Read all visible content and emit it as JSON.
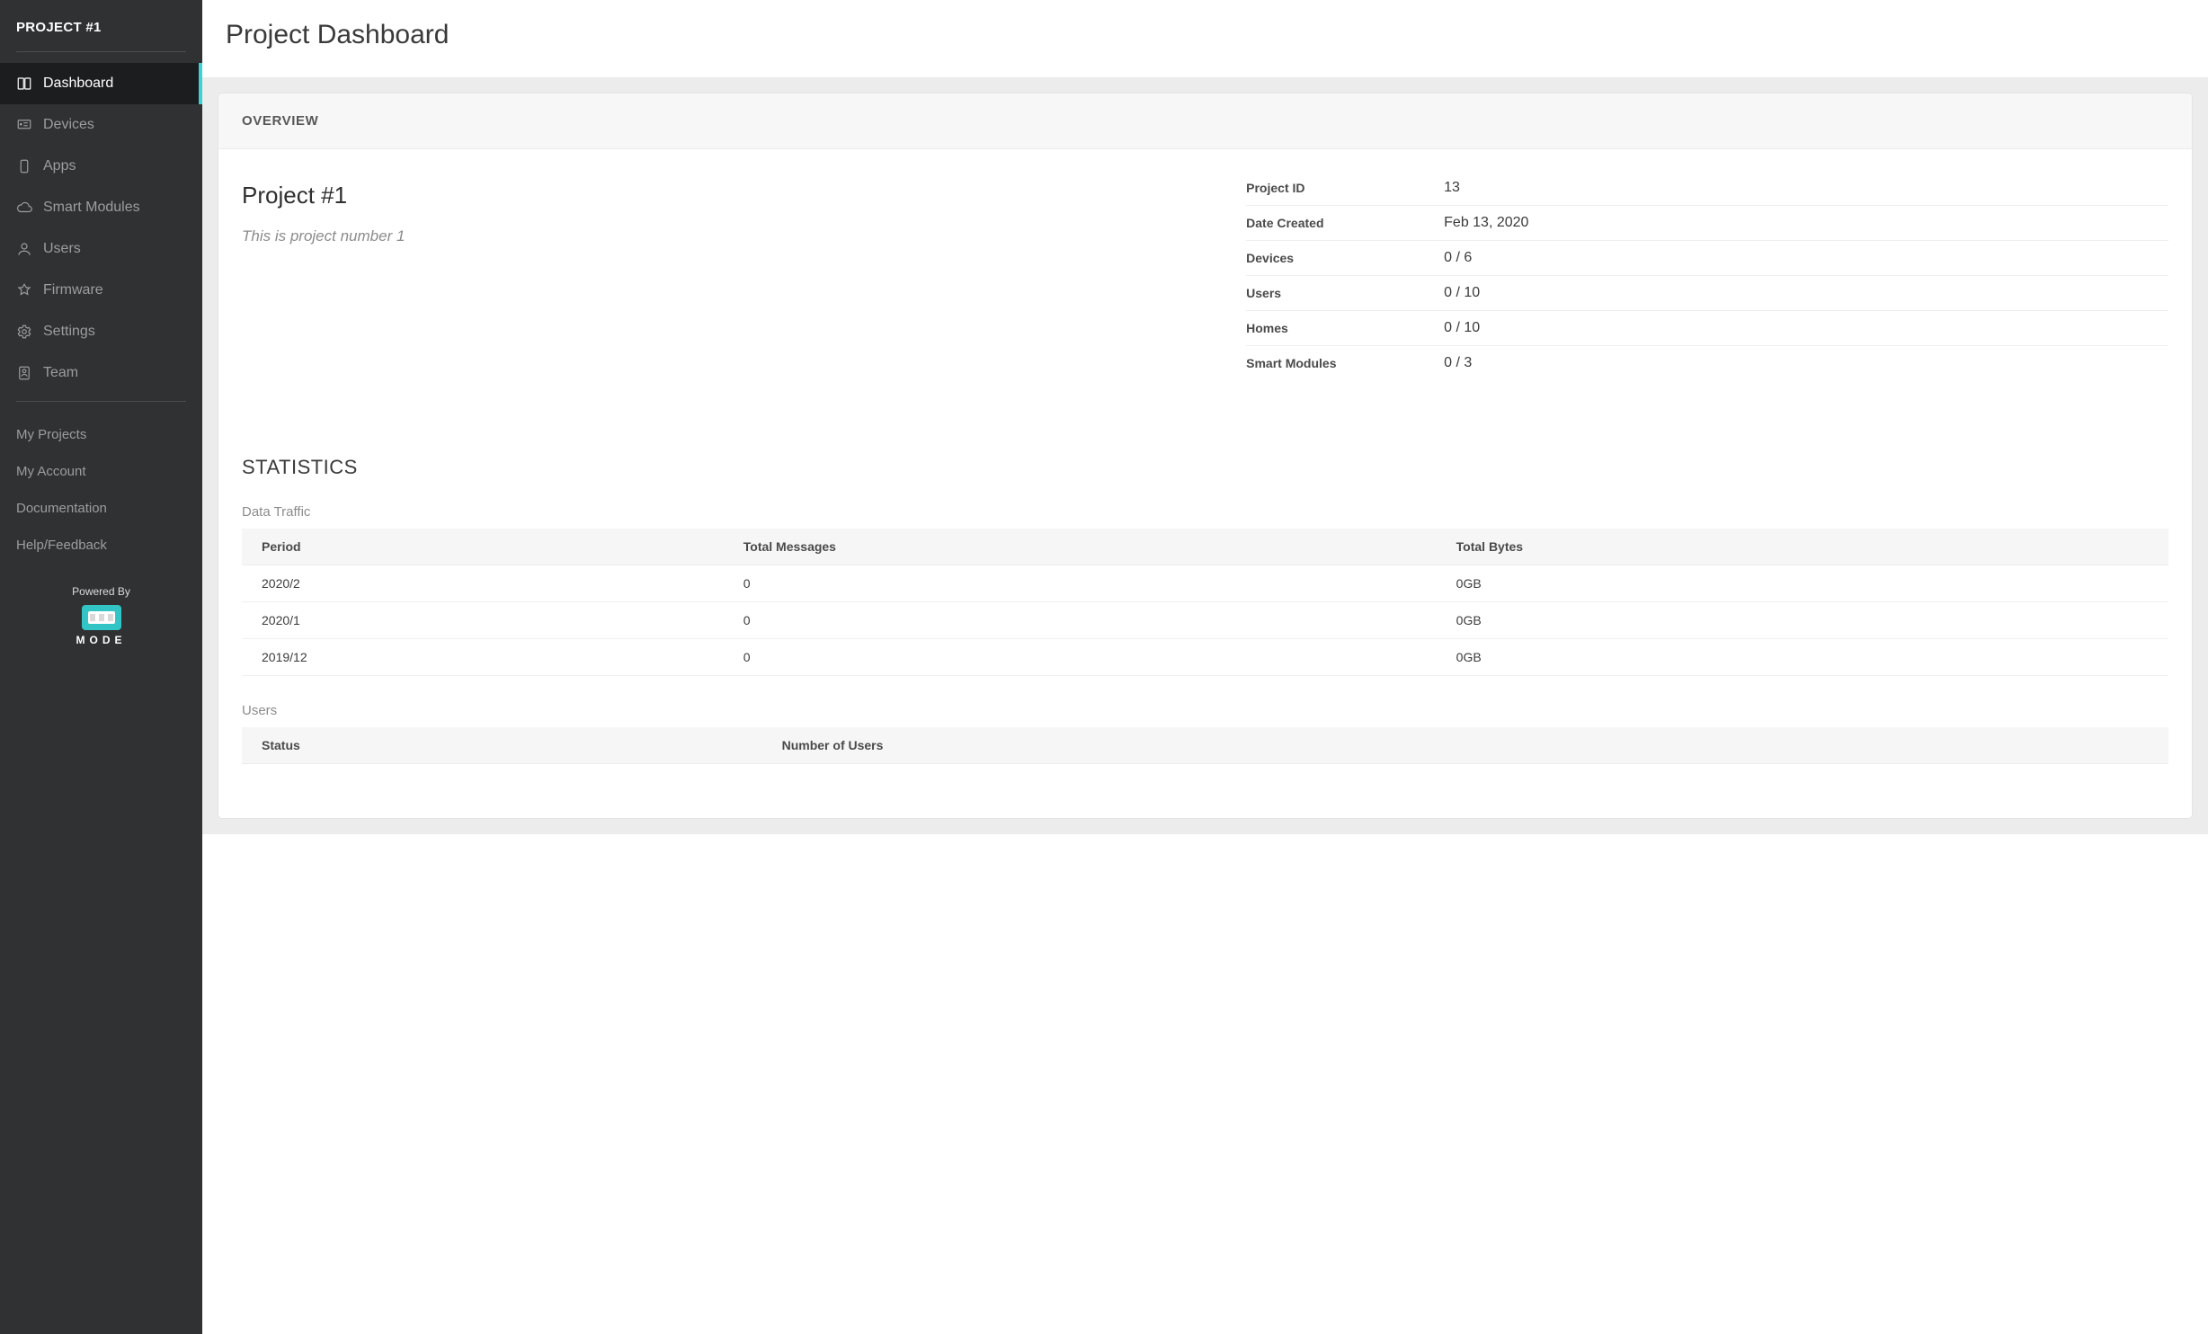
{
  "sidebar": {
    "project_label": "PROJECT #1",
    "items": [
      {
        "label": "Dashboard",
        "icon": "dashboard-icon",
        "active": true
      },
      {
        "label": "Devices",
        "icon": "devices-icon",
        "active": false
      },
      {
        "label": "Apps",
        "icon": "apps-icon",
        "active": false
      },
      {
        "label": "Smart Modules",
        "icon": "cloud-icon",
        "active": false
      },
      {
        "label": "Users",
        "icon": "user-icon",
        "active": false
      },
      {
        "label": "Firmware",
        "icon": "firmware-icon",
        "active": false
      },
      {
        "label": "Settings",
        "icon": "gear-icon",
        "active": false
      },
      {
        "label": "Team",
        "icon": "team-icon",
        "active": false
      }
    ],
    "secondary": [
      {
        "label": "My Projects"
      },
      {
        "label": "My Account"
      },
      {
        "label": "Documentation"
      },
      {
        "label": "Help/Feedback"
      }
    ],
    "powered_by": "Powered By",
    "brand": "MODE"
  },
  "page": {
    "title": "Project Dashboard"
  },
  "overview": {
    "heading": "OVERVIEW",
    "project_name": "Project #1",
    "project_desc": "This is project number 1",
    "meta": [
      {
        "label": "Project ID",
        "value": "13"
      },
      {
        "label": "Date Created",
        "value": "Feb 13, 2020"
      },
      {
        "label": "Devices",
        "value": "0 / 6"
      },
      {
        "label": "Users",
        "value": "0 / 10"
      },
      {
        "label": "Homes",
        "value": "0 / 10"
      },
      {
        "label": "Smart Modules",
        "value": "0 / 3"
      }
    ]
  },
  "statistics": {
    "heading": "STATISTICS",
    "data_traffic": {
      "title": "Data Traffic",
      "columns": [
        "Period",
        "Total Messages",
        "Total Bytes"
      ],
      "rows": [
        {
          "c0": "2020/2",
          "c1": "0",
          "c2": "0GB"
        },
        {
          "c0": "2020/1",
          "c1": "0",
          "c2": "0GB"
        },
        {
          "c0": "2019/12",
          "c1": "0",
          "c2": "0GB"
        }
      ]
    },
    "users": {
      "title": "Users",
      "columns": [
        "Status",
        "Number of Users"
      ]
    }
  }
}
